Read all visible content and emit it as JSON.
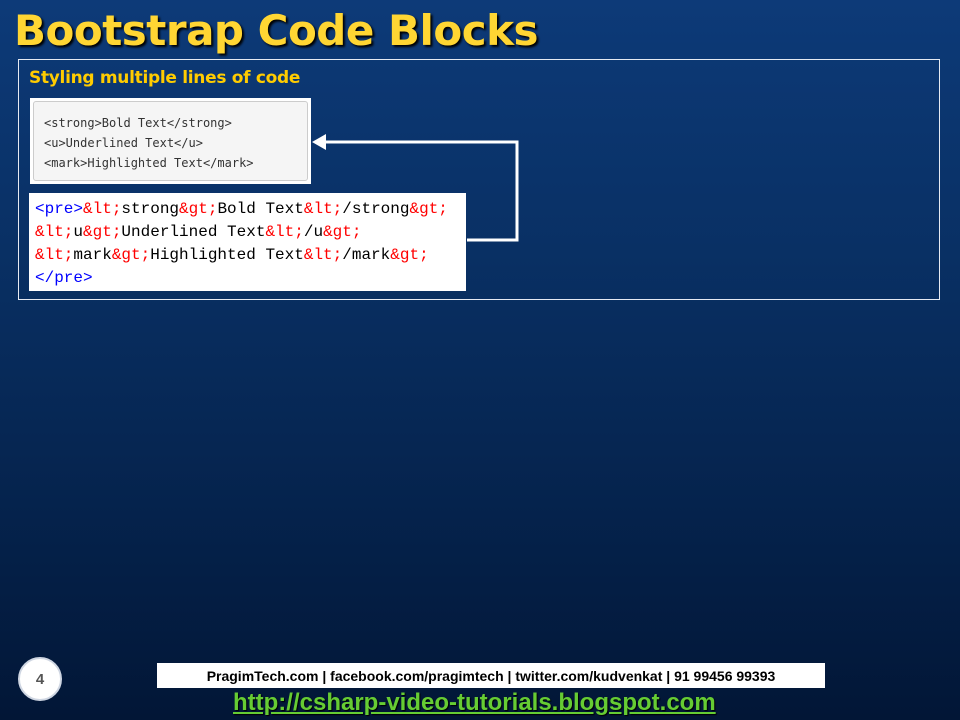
{
  "slide": {
    "title": "Bootstrap Code Blocks",
    "subtitle": "Styling multiple lines of code",
    "page_number": "4"
  },
  "rendered_output": {
    "lines": [
      "<strong>Bold Text</strong>",
      "<u>Underlined Text</u>",
      "<mark>Highlighted Text</mark>"
    ]
  },
  "source_code": {
    "line1": {
      "open_tag": "<pre>",
      "p1": "&lt;",
      "p2": "strong",
      "p3": "&gt;",
      "p4": "Bold Text",
      "p5": "&lt;",
      "p6": "/strong",
      "p7": "&gt;"
    },
    "line2": {
      "p1": "&lt;",
      "p2": "u",
      "p3": "&gt;",
      "p4": "Underlined Text",
      "p5": "&lt;",
      "p6": "/u",
      "p7": "&gt;"
    },
    "line3": {
      "p1": "&lt;",
      "p2": "mark",
      "p3": "&gt;",
      "p4": "Highlighted Text",
      "p5": "&lt;",
      "p6": "/mark",
      "p7": "&gt;"
    },
    "line4": {
      "close_tag": "</pre>"
    }
  },
  "footer": {
    "info": "PragimTech.com | facebook.com/pragimtech  | twitter.com/kudvenkat  | 91 99456 99393",
    "link": "http://csharp-video-tutorials.blogspot.com"
  },
  "colors": {
    "title": "#ffd633",
    "subtitle": "#ffcc00",
    "tag": "#0000ff",
    "entity": "#ff0000",
    "link": "#66cc33",
    "background_top": "#0d3a78",
    "background_bottom": "#021636"
  }
}
